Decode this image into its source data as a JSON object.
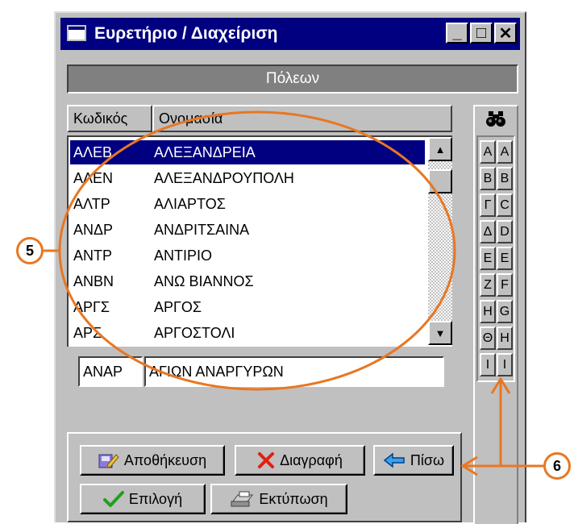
{
  "window": {
    "title": "Ευρετήριο / Διαχείριση",
    "minimize_label": "_",
    "maximize_label": "□",
    "close_label": "✕"
  },
  "header": {
    "title": "Πόλεων"
  },
  "columns": {
    "code": "Κωδικός",
    "name": "Ονομασία"
  },
  "rows": [
    {
      "code": "ΑΛΕΒ",
      "name": "ΑΛΕΞΑΝΔΡΕΙΑ",
      "selected": true
    },
    {
      "code": "ΑΛΕΝ",
      "name": "ΑΛΕΞΑΝΔΡΟΥΠΟΛΗ"
    },
    {
      "code": "ΑΛΤΡ",
      "name": "ΑΛΙΑΡΤΟΣ"
    },
    {
      "code": "ΑΝΔΡ",
      "name": "ΑΝΔΡΙΤΣΑΙΝΑ"
    },
    {
      "code": "ΑΝΤΡ",
      "name": "ΑΝΤΙΡΙΟ"
    },
    {
      "code": "ΑΝΒΝ",
      "name": "ΑΝΩ ΒΙΑΝΝΟΣ"
    },
    {
      "code": "ΑΡΓΣ",
      "name": "ΑΡΓΟΣ"
    },
    {
      "code": "ΑΡΣ",
      "name": "ΑΡΓΟΣΤΟΛΙ"
    }
  ],
  "edit": {
    "code_value": "ΑΝΑΡ",
    "name_value": "ΑΓΙΩΝ ΑΝΑΡΓΥΡΩΝ"
  },
  "letters_greek": [
    "Α",
    "Β",
    "Γ",
    "Δ",
    "Ε",
    "Ζ",
    "Η",
    "Θ",
    "Ι"
  ],
  "letters_latin": [
    "A",
    "B",
    "C",
    "D",
    "E",
    "F",
    "G",
    "H",
    "I"
  ],
  "buttons": {
    "save": "Αποθήκευση",
    "delete": "Διαγραφή",
    "back": "Πίσω",
    "select": "Επιλογή",
    "print": "Εκτύπωση"
  },
  "annotations": {
    "five": "5",
    "six": "6"
  },
  "colors": {
    "annotation": "#e87722",
    "selection": "#000080",
    "title_bar": "#000080"
  }
}
